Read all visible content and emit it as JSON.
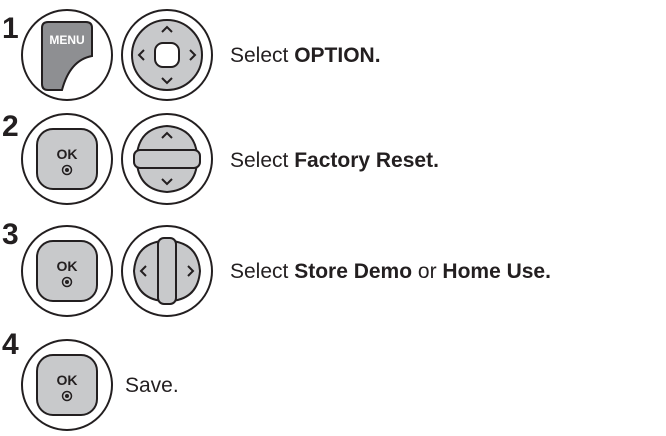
{
  "steps": [
    {
      "number": "1",
      "buttons": [
        "menu-button-icon",
        "four-way-nav-icon"
      ],
      "button_label": "MENU",
      "text": {
        "prefix": "Select ",
        "bold1": "OPTION.",
        "mid": "",
        "bold2": ""
      }
    },
    {
      "number": "2",
      "buttons": [
        "ok-button-icon",
        "up-down-nav-icon"
      ],
      "button_label": "OK",
      "text": {
        "prefix": "Select ",
        "bold1": "Factory Reset.",
        "mid": "",
        "bold2": ""
      }
    },
    {
      "number": "3",
      "buttons": [
        "ok-button-icon",
        "left-right-nav-icon"
      ],
      "button_label": "OK",
      "text": {
        "prefix": "Select ",
        "bold1": "Store Demo",
        "mid": " or ",
        "bold2": "Home Use."
      }
    },
    {
      "number": "4",
      "buttons": [
        "ok-button-icon"
      ],
      "button_label": "OK",
      "text": {
        "prefix": "Save.",
        "bold1": "",
        "mid": "",
        "bold2": ""
      }
    }
  ],
  "colors": {
    "button_fill": "#c8c9cb",
    "button_stroke": "#231f20",
    "menu_fill": "#8e8f92",
    "text": "#231f20"
  }
}
